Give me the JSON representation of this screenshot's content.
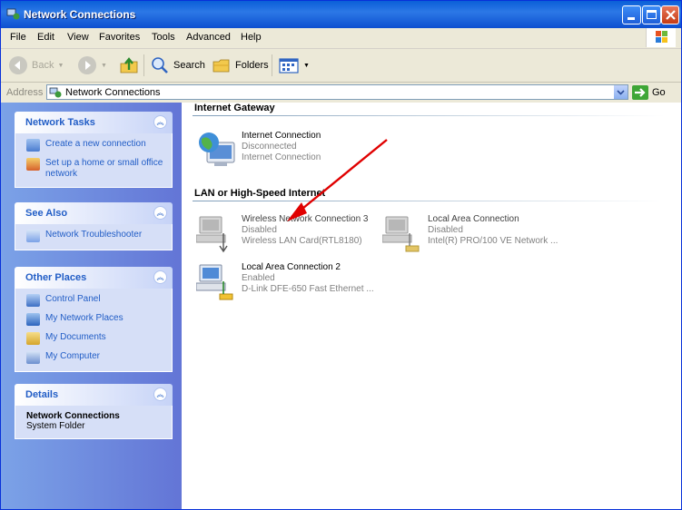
{
  "window": {
    "title": "Network Connections"
  },
  "menu": [
    "File",
    "Edit",
    "View",
    "Favorites",
    "Tools",
    "Advanced",
    "Help"
  ],
  "toolbar": {
    "back": "Back",
    "search": "Search",
    "folders": "Folders"
  },
  "address": {
    "label": "Address",
    "value": "Network Connections",
    "go": "Go"
  },
  "sidebar": {
    "network_tasks": {
      "title": "Network Tasks",
      "items": [
        "Create a new connection",
        "Set up a home or small office network"
      ]
    },
    "see_also": {
      "title": "See Also",
      "items": [
        "Network Troubleshooter"
      ]
    },
    "other_places": {
      "title": "Other Places",
      "items": [
        "Control Panel",
        "My Network Places",
        "My Documents",
        "My Computer"
      ]
    },
    "details": {
      "title": "Details",
      "name": "Network Connections",
      "type": "System Folder"
    }
  },
  "groups": {
    "gateway": {
      "title": "Internet Gateway"
    },
    "lan": {
      "title": "LAN or High-Speed Internet"
    }
  },
  "connections": {
    "internet": {
      "name": "Internet Connection",
      "status": "Disconnected",
      "device": "Internet Connection"
    },
    "wireless": {
      "name": "Wireless Network Connection 3",
      "status": "Disabled",
      "device": "Wireless LAN Card(RTL8180)"
    },
    "local1": {
      "name": "Local Area Connection",
      "status": "Disabled",
      "device": "Intel(R) PRO/100 VE Network ..."
    },
    "local2": {
      "name": "Local Area Connection 2",
      "status": "Enabled",
      "device": "D-Link DFE-650 Fast Ethernet ..."
    }
  },
  "colors": {
    "title_blue": "#0a5fd8",
    "sidebar_blue": "#7ba2e7",
    "link_blue": "#215dc6",
    "arrow_red": "#e00000"
  },
  "icons": [
    "network-connections-icon",
    "back-icon",
    "forward-icon",
    "up-folder-icon",
    "search-icon",
    "folders-icon",
    "views-icon",
    "windows-logo-icon",
    "go-icon",
    "chevron-up-icon",
    "globe-computer-icon",
    "network-computer-icon",
    "annotation-arrow-icon"
  ]
}
